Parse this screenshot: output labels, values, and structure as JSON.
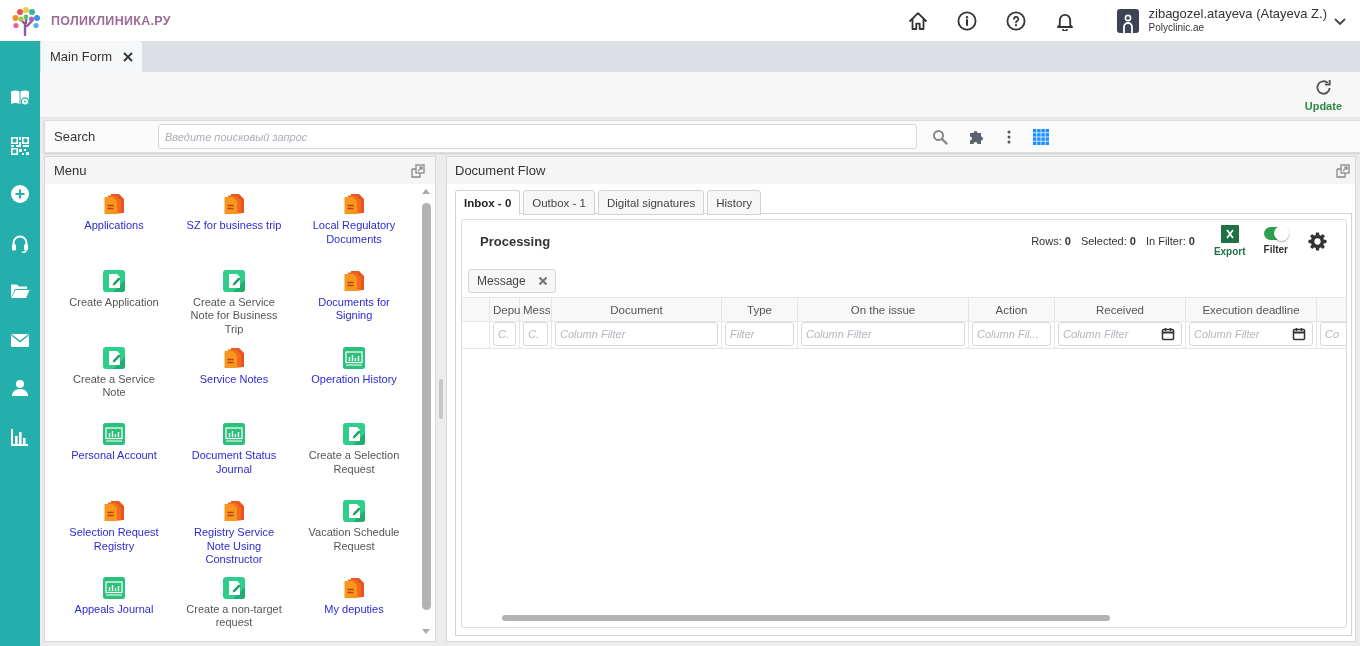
{
  "header": {
    "logo": "ПОЛИКЛИНИКА.РУ",
    "user": {
      "name": "zibagozel.atayeva (Atayeva Z.)",
      "organization": "Polyclinic.ae"
    }
  },
  "tabs": [
    {
      "label": "Main Form",
      "selected": true
    }
  ],
  "toolbar": {
    "update": "Update"
  },
  "search": {
    "label": "Search",
    "placeholder": "Введите поисковый запрос"
  },
  "menu": {
    "title": "Menu",
    "items": [
      {
        "label": "Applications",
        "kind": "registry"
      },
      {
        "label": "SZ for business trip",
        "kind": "registry"
      },
      {
        "label": "Local Regulatory Documents",
        "kind": "registry"
      },
      {
        "label": "Create Application",
        "kind": "create"
      },
      {
        "label": "Create a Service Note for Business Trip",
        "kind": "create"
      },
      {
        "label": "Documents for Signing",
        "kind": "registry"
      },
      {
        "label": "Create a Service Note",
        "kind": "create"
      },
      {
        "label": "Service Notes",
        "kind": "registry"
      },
      {
        "label": "Operation History",
        "kind": "journal"
      },
      {
        "label": "Personal Account",
        "kind": "journal"
      },
      {
        "label": "Document Status Journal",
        "kind": "journal"
      },
      {
        "label": "Create a Selection Request",
        "kind": "create"
      },
      {
        "label": "Selection Request Registry",
        "kind": "registry"
      },
      {
        "label": "Registry Service Note Using Constructor",
        "kind": "registry"
      },
      {
        "label": "Vacation Schedule Request",
        "kind": "create"
      },
      {
        "label": "Appeals Journal",
        "kind": "journal"
      },
      {
        "label": "Create a non-target request",
        "kind": "create"
      },
      {
        "label": "My deputies",
        "kind": "registry"
      }
    ]
  },
  "document_flow": {
    "title": "Document Flow",
    "tabs": [
      {
        "label": "Inbox - 0",
        "selected": true
      },
      {
        "label": "Outbox - 1",
        "selected": false
      },
      {
        "label": "Digital signatures",
        "selected": false
      },
      {
        "label": "History",
        "selected": false
      }
    ],
    "grid": {
      "title": "Processing",
      "stats": [
        "Rows: **0**",
        "Selected: **0**",
        "In Filter: **0**"
      ],
      "export": "Export",
      "filter": {
        "label": "Filter",
        "on": true
      },
      "chips": [
        {
          "label": "Message"
        }
      ],
      "columns": [
        {
          "header": "Depu",
          "filter_placeholder": "C.",
          "kind": "text"
        },
        {
          "header": "Mess",
          "filter_placeholder": "C.",
          "kind": "text"
        },
        {
          "header": "Document",
          "filter_placeholder": "Column Filter",
          "kind": "text"
        },
        {
          "header": "Type",
          "filter_placeholder": "Filter",
          "kind": "text"
        },
        {
          "header": "On the issue",
          "filter_placeholder": "Column Filter",
          "kind": "text"
        },
        {
          "header": "Action",
          "filter_placeholder": "Column Fil...",
          "kind": "text"
        },
        {
          "header": "Received",
          "filter_placeholder": "Column Filter",
          "kind": "date"
        },
        {
          "header": "Execution deadline",
          "filter_placeholder": "Column Filter",
          "kind": "date"
        },
        {
          "filter_placeholder": "Co",
          "kind": "text"
        }
      ]
    }
  }
}
